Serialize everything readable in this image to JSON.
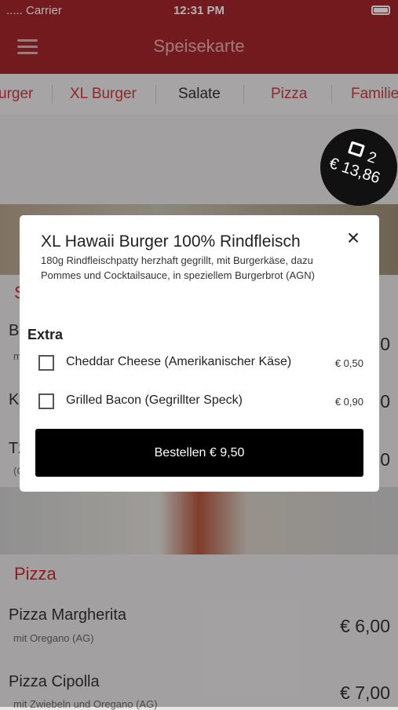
{
  "status": {
    "carrier": "..... Carrier",
    "time": "12:31 PM"
  },
  "navbar": {
    "title": "Speisekarte",
    "menu_icon": "hamburger-icon"
  },
  "tabs": [
    {
      "label": "urger"
    },
    {
      "label": "XL Burger"
    },
    {
      "label": "Salate",
      "active": true
    },
    {
      "label": "Pizza"
    },
    {
      "label": "Familie"
    }
  ],
  "cart": {
    "count": "2",
    "total": "€ 13,86",
    "icon": "shopping-bag-icon"
  },
  "menu": {
    "salad_header_fragment": "S",
    "items_behind": [
      {
        "name": "B",
        "desc": "m",
        "price": "0"
      },
      {
        "name": "K",
        "desc": "",
        "price": "0"
      },
      {
        "name": "Tz",
        "desc": "(C",
        "price": "0"
      }
    ],
    "pizza_header": "Pizza",
    "pizza_items": [
      {
        "name": "Pizza Margherita",
        "desc": "mit Oregano (AG)",
        "price": "€ 6,00"
      },
      {
        "name": "Pizza Cipolla",
        "desc": "mit Zwiebeln und Oregano (AG)",
        "price": "€ 7,00"
      }
    ]
  },
  "modal": {
    "title": "XL Hawaii Burger 100% Rindfleisch",
    "description": "180g Rindfleischpatty herzhaft gegrillt, mit Burgerkäse, dazu Pommes und Cocktailsauce, in speziellem Burgerbrot (AGN)",
    "extra_label": "Extra",
    "options": [
      {
        "label": "Cheddar Cheese  (Amerikanischer Käse)",
        "price": "€ 0,50",
        "checked": false
      },
      {
        "label": "Grilled Bacon  (Gegrillter Speck)",
        "price": "€ 0,90",
        "checked": false
      }
    ],
    "order_button": "Bestellen € 9,50"
  },
  "colors": {
    "brand": "#a5262c",
    "accent": "#cc2a31"
  }
}
